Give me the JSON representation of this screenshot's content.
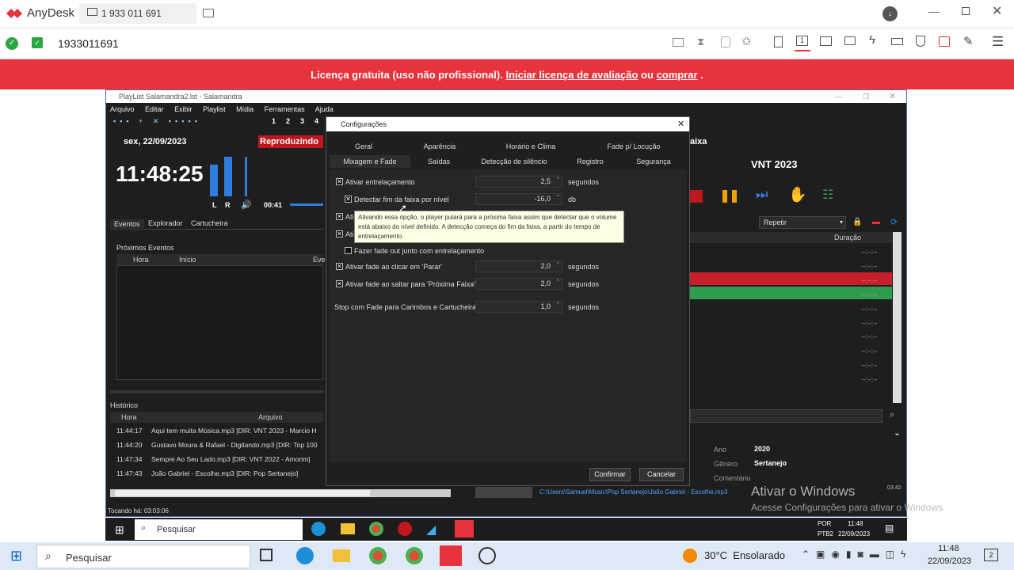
{
  "anydesk": {
    "brand": "AnyDesk",
    "tab_address": "1 933 011 691",
    "address": "1933011691"
  },
  "license": {
    "prefix": "Licença gratuita (uso não profissional).",
    "link1": "Iniciar licença de avaliação",
    "middle": "ou",
    "link2": "comprar",
    "suffix": "."
  },
  "salamandra": {
    "window_title": "PlayList Salamandra2.lst - Salamandra",
    "menu": [
      "Arquivo",
      "Editar",
      "Exibir",
      "Playlist",
      "Mídia",
      "Ferramentas",
      "Ajuda"
    ],
    "toolbar_numbers": [
      "1",
      "2",
      "3",
      "4"
    ],
    "date": "sex, 22/09/2023",
    "clock": "11:48:25",
    "playing": "Reproduzindo",
    "vu_l": "L",
    "vu_r": "R",
    "elapsed": "00:41",
    "tabs": [
      "Eventos",
      "Explorador",
      "Cartucheira"
    ],
    "next_events": "Próximos Eventos",
    "events_cols": [
      "Hora",
      "Início",
      "Eve"
    ],
    "history_title": "Histórico",
    "history_cols": [
      "Hora",
      "Arquivo"
    ],
    "history": [
      {
        "time": "11:44:17",
        "file": "Aqui tem muita Música.mp3 [DIR: VNT 2023 - Marcio H"
      },
      {
        "time": "11:44:20",
        "file": "Gustavo Moura & Rafael - Digitando.mp3 [DIR: Top 100"
      },
      {
        "time": "11:47:34",
        "file": "Sempre Ao Seu Lado.mp3 [DIR: VNT 2022 - Amorim]"
      },
      {
        "time": "11:47:43",
        "file": "João Gabriel - Escolhe.mp3 [DIR: Pop Sertanejo]"
      }
    ],
    "right_partial": "aixa",
    "playlist_title": "VNT 2023",
    "repeat": "Repetir",
    "duration_col": "Duração",
    "duration_placeholder": "--:--:--",
    "meta": {
      "ano_label": "Ano",
      "ano": "2020",
      "genero_label": "Gênero",
      "genero": "Sertanejo",
      "comentario_label": "Comentário"
    },
    "path": "C:\\Users\\Samuel\\Music\\Pop Sertanejo\\João Gabriel - Escolhe.mp3",
    "time_small": "03:42",
    "tocando": "Tocando há: 03:03:06"
  },
  "dialog": {
    "title": "Configurações",
    "tabs_row1": [
      "Geral",
      "Aparência",
      "Horário e Clima",
      "Fade p/ Locução"
    ],
    "tabs_row2": [
      "Mixagem e Fade",
      "Saídas",
      "Detecção de silêncio",
      "Registro",
      "Segurança"
    ],
    "opt1": {
      "label": "Ativar entrelaçamento",
      "value": "2,5",
      "unit": "segundos"
    },
    "opt2": {
      "label": "Detectar fim da faixa por nível",
      "value": "-16,0",
      "unit": "db"
    },
    "opt3_partial": "Ati",
    "opt4_partial": "Ati",
    "opt5": {
      "label": "Fazer fade out junto com entrelaçamento"
    },
    "opt6": {
      "label": "Ativar fade ao clicar em 'Parar'",
      "value": "2,0",
      "unit": "segundos"
    },
    "opt7": {
      "label": "Ativar fade ao saltar para 'Próxima Faixa'",
      "value": "2,0",
      "unit": "segundos"
    },
    "opt8": {
      "label": "Stop com Fade para Carimbos e Cartucheira",
      "value": "1,0",
      "unit": "segundos"
    },
    "tooltip": "Ativando essa opção, o player pulará para a próxima faixa assim que detectar que o volume está abaixo do nível definido. A detecção começa do fim da faixa, a partir do tempo de entrelaçamento.",
    "confirm": "Confirmar",
    "cancel": "Cancelar"
  },
  "windows_watermark": {
    "line1": "Ativar o Windows",
    "line2": "Acesse Configurações para ativar o Windows."
  },
  "remote_taskbar": {
    "search": "Pesquisar",
    "lang1": "POR",
    "lang2": "PTB2",
    "time": "11:48",
    "date": "22/09/2023"
  },
  "local_taskbar": {
    "search": "Pesquisar",
    "weather": "30°C  Ensolarado",
    "time": "11:48",
    "date": "22/09/2023",
    "notif": "2"
  }
}
